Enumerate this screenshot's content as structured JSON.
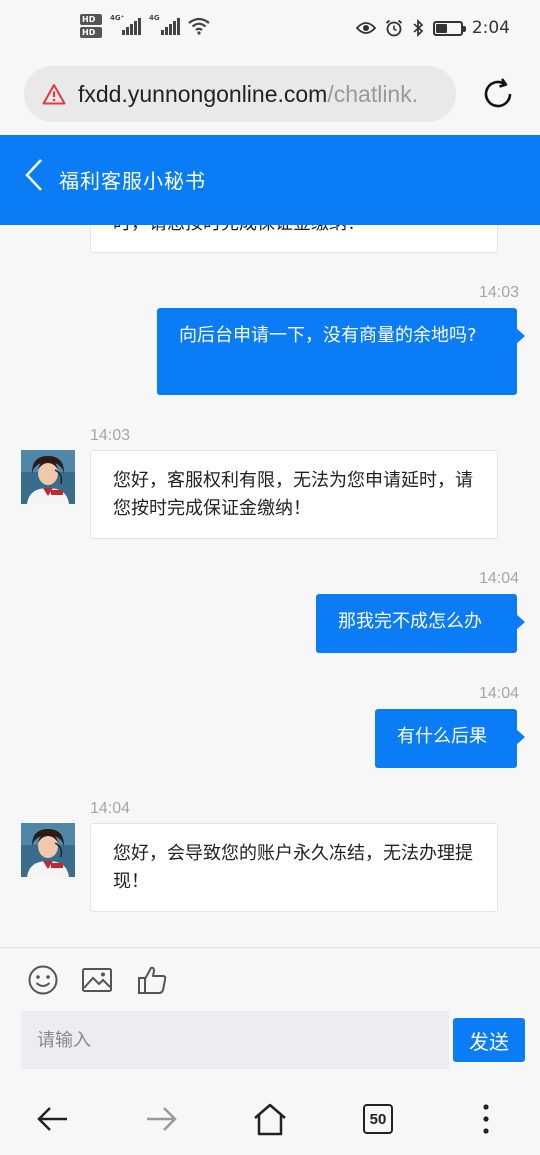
{
  "status_bar": {
    "hd1": "HD",
    "hd2": "HD",
    "net1": "4G⁺",
    "net2": "4G",
    "time": "2:04",
    "battery_level": 0.45
  },
  "browser": {
    "url_host": "fxdd.yunnongonline.com",
    "url_path": "/chatlink.",
    "tabs_count": "50"
  },
  "header": {
    "title": "福利客服小秘书"
  },
  "chat": {
    "partial_message": "时，请您按时完成保证金缴纳！",
    "messages": [
      {
        "time": "14:03",
        "text": "向后台申请一下，没有商量的余地吗?"
      },
      {
        "time": "14:03",
        "text": "您好，客服权利有限，无法为您申请延时，请您按时完成保证金缴纳！"
      },
      {
        "time": "14:04",
        "text": "那我完不成怎么办"
      },
      {
        "time": "14:04",
        "text": "有什么后果"
      },
      {
        "time": "14:04",
        "text": "您好，会导致您的账户永久冻结，无法办理提现！"
      }
    ]
  },
  "input": {
    "placeholder": "请输入",
    "send_label": "发送"
  },
  "colors": {
    "accent": "#0a7cf5",
    "background": "#f7f7f7"
  }
}
